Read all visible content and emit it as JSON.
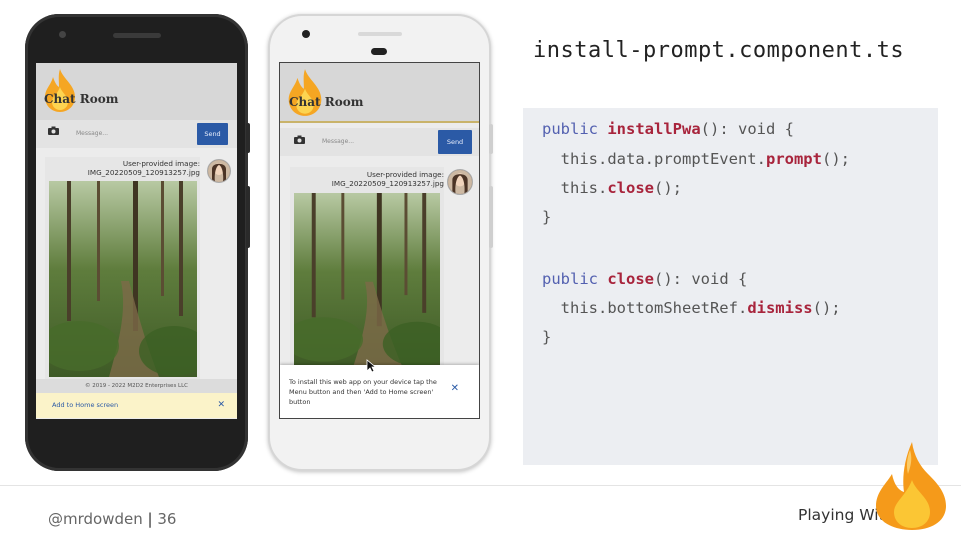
{
  "slide": {
    "file_title": "install-prompt.component.ts",
    "handle": "@mrdowden",
    "separator": "|",
    "page_number": "36",
    "brand": "Playing With Fire"
  },
  "phone_app": {
    "title": "Chat Room",
    "message_placeholder": "Message...",
    "send_label": "Send",
    "image_caption_line1": "User-provided image:",
    "image_caption_line2": "IMG_20220509_120913257.jpg",
    "footer": "© 2019 - 2022 M2D2 Enterprises LLC",
    "add_to_home": "Add to Home screen",
    "install_instructions": "To install this web app on your device tap the Menu button and then 'Add to Home screen' button",
    "close_glyph": "✕"
  },
  "code": {
    "line1": {
      "kw": "public ",
      "fn": "installPwa",
      "rest": "(): void {"
    },
    "line2": {
      "indent": "  ",
      "pre": "this.data.promptEvent.",
      "fn": "prompt",
      "post": "();"
    },
    "line3": {
      "indent": "  ",
      "pre": "this.",
      "fn": "close",
      "post": "();"
    },
    "line4": {
      "text": "}"
    },
    "line5": {
      "kw": "public ",
      "fn": "close",
      "rest": "(): void {"
    },
    "line6": {
      "indent": "  ",
      "pre": "this.bottomSheetRef.",
      "fn": "dismiss",
      "post": "();"
    },
    "line7": {
      "text": "}"
    }
  },
  "colors": {
    "keyword": "#5360b0",
    "function_name": "#a8243c",
    "send_button": "#2b5aa6",
    "a2hs_bar": "#fbf3c9",
    "flame_orange": "#f59a1a"
  },
  "icons": {
    "camera": "camera-icon",
    "close": "close-icon",
    "flame": "flame-logo-icon"
  }
}
